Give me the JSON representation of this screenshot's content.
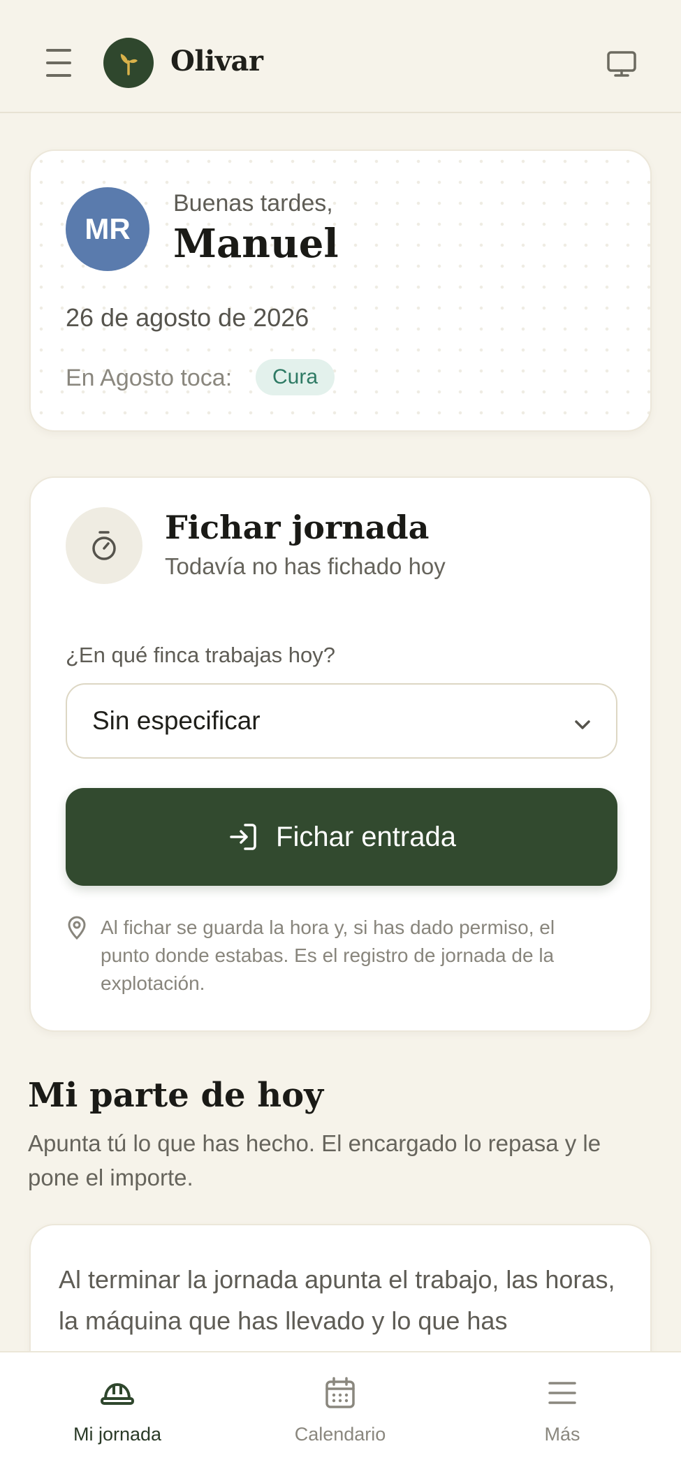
{
  "header": {
    "brand": "Olivar",
    "accent": "#2f472d"
  },
  "greeting": {
    "initials": "MR",
    "label": "Buenas tardes,",
    "name": "Manuel",
    "date": "26 de agosto de 2026",
    "season_label": "En Agosto toca:",
    "season_value": "Cura"
  },
  "clock": {
    "title": "Fichar jornada",
    "subtitle": "Todavía no has fichado hoy",
    "farm_question": "¿En qué finca trabajas hoy?",
    "farm_selected": "Sin especificar",
    "button_label": "Fichar entrada",
    "note": "Al fichar se guarda la hora y, si has dado permiso, el punto donde estabas. Es el registro de jornada de la explotación."
  },
  "report": {
    "title": "Mi parte de hoy",
    "subtitle": "Apunta tú lo que has hecho. El encargado lo repasa y le pone el importe.",
    "body": "Al terminar la jornada apunta el trabajo, las horas, la máquina que has llevado y lo que has"
  },
  "nav": {
    "items": [
      {
        "label": "Mi jornada",
        "icon": "hard-hat-icon",
        "active": true
      },
      {
        "label": "Calendario",
        "icon": "calendar-icon",
        "active": false
      },
      {
        "label": "Más",
        "icon": "menu-icon",
        "active": false
      }
    ]
  }
}
